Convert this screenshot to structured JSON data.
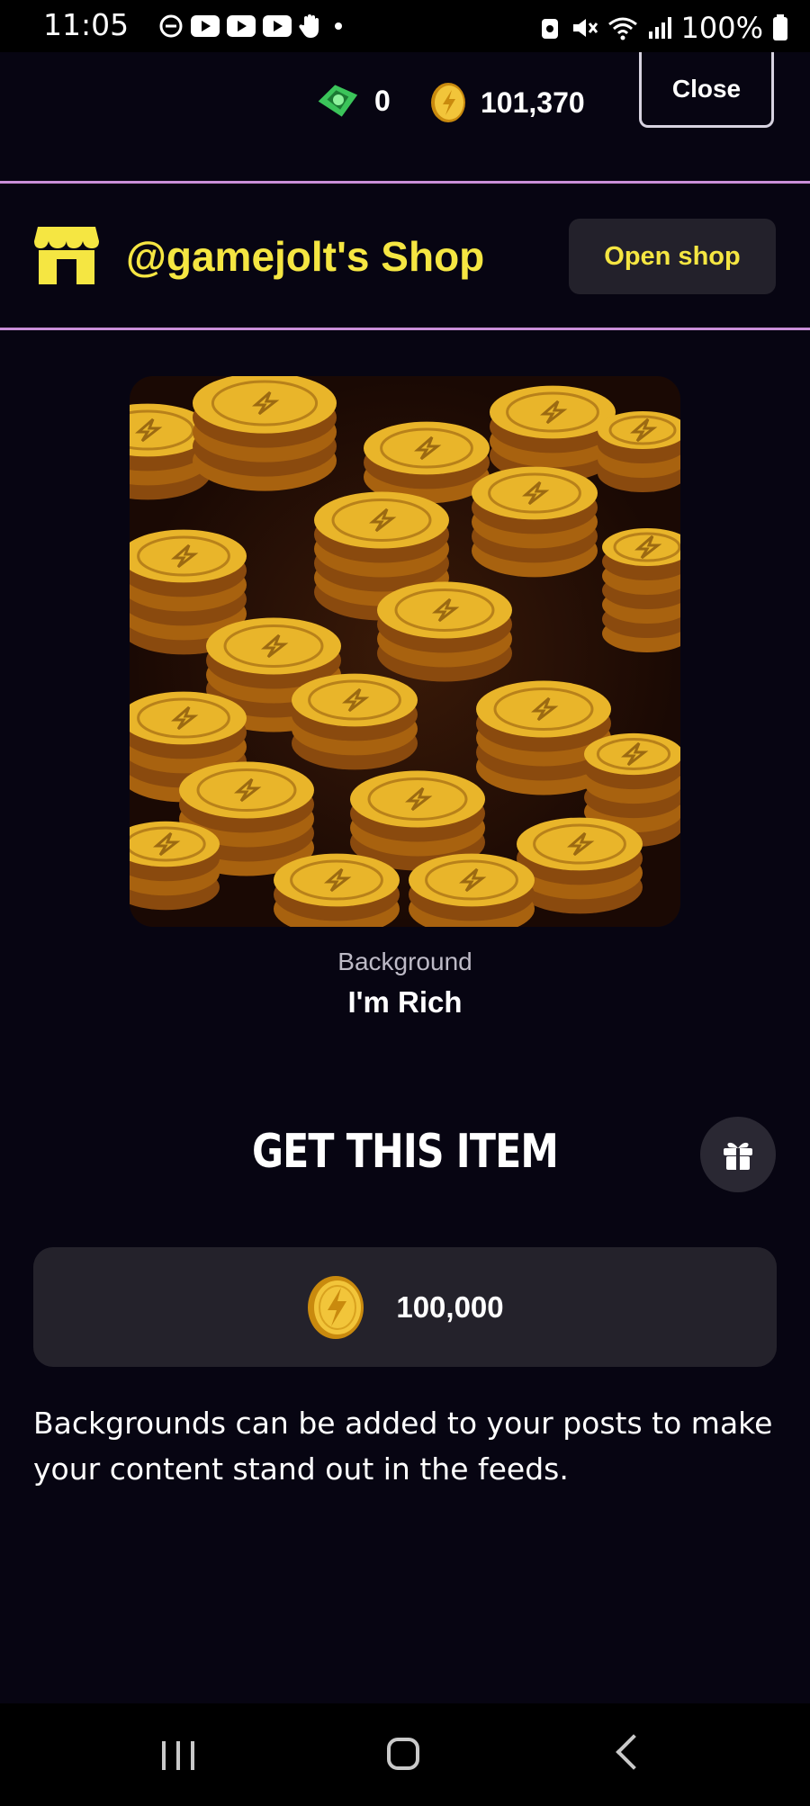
{
  "status_bar": {
    "time": "11:05",
    "battery": "100%",
    "icons_left": [
      "do-not-disturb-icon",
      "youtube-icon",
      "youtube-icon",
      "youtube-icon",
      "hand-icon",
      "dot-icon"
    ],
    "icons_right": [
      "lock-icon",
      "mute-icon",
      "wifi-icon",
      "signal-icon",
      "battery-icon"
    ]
  },
  "topbar": {
    "gems_count": "0",
    "coins_count": "101,370",
    "close_label": "Close"
  },
  "shop": {
    "title": "@gamejolt's Shop",
    "open_label": "Open shop"
  },
  "item": {
    "type": "Background",
    "name": "I'm Rich",
    "art_icon": "coin-pile-image"
  },
  "purchase": {
    "heading": "GET THIS ITEM",
    "price": "100,000",
    "description": "Backgrounds can be added to your posts to make your content stand out in the feeds."
  },
  "colors": {
    "background": "#070512",
    "accent_yellow": "#f5e642",
    "divider": "#c98fd8",
    "button_bg": "#24222b",
    "coin_gold": "#e8b41c"
  }
}
